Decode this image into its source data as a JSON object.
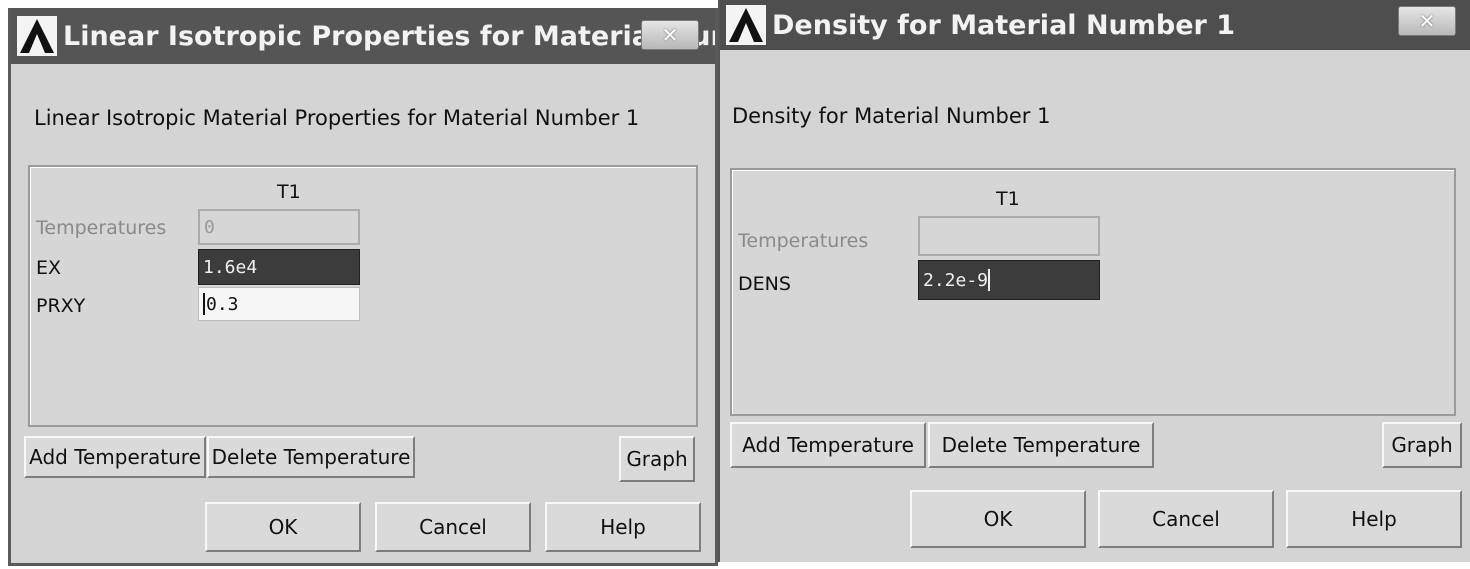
{
  "dialog1": {
    "title": "Linear Isotropic Properties for Material Num...",
    "close_label": "✕",
    "heading": "Linear Isotropic Material Properties for Material Number 1",
    "column_header": "T1",
    "rows": [
      {
        "label": "Temperatures",
        "value": "0"
      },
      {
        "label": "EX",
        "value": "1.6e4"
      },
      {
        "label": "PRXY",
        "value": "0.3"
      }
    ],
    "buttons": {
      "add_temperature": "Add Temperature",
      "delete_temperature": "Delete Temperature",
      "graph": "Graph",
      "ok": "OK",
      "cancel": "Cancel",
      "help": "Help"
    }
  },
  "dialog2": {
    "title": "Density for Material Number 1",
    "close_label": "✕",
    "heading": "Density for Material Number 1",
    "column_header": "T1",
    "rows": [
      {
        "label": "Temperatures",
        "value": ""
      },
      {
        "label": "DENS",
        "value": "2.2e-9"
      }
    ],
    "buttons": {
      "add_temperature": "Add Temperature",
      "delete_temperature": "Delete Temperature",
      "graph": "Graph",
      "ok": "OK",
      "cancel": "Cancel",
      "help": "Help"
    }
  },
  "icons": {
    "app_logo": "ansys-logo-icon",
    "close": "close-icon"
  },
  "colors": {
    "titlebar": "#555555",
    "dialog_bg": "#d4d4d4",
    "selected_cell": "#3c3c3c"
  }
}
